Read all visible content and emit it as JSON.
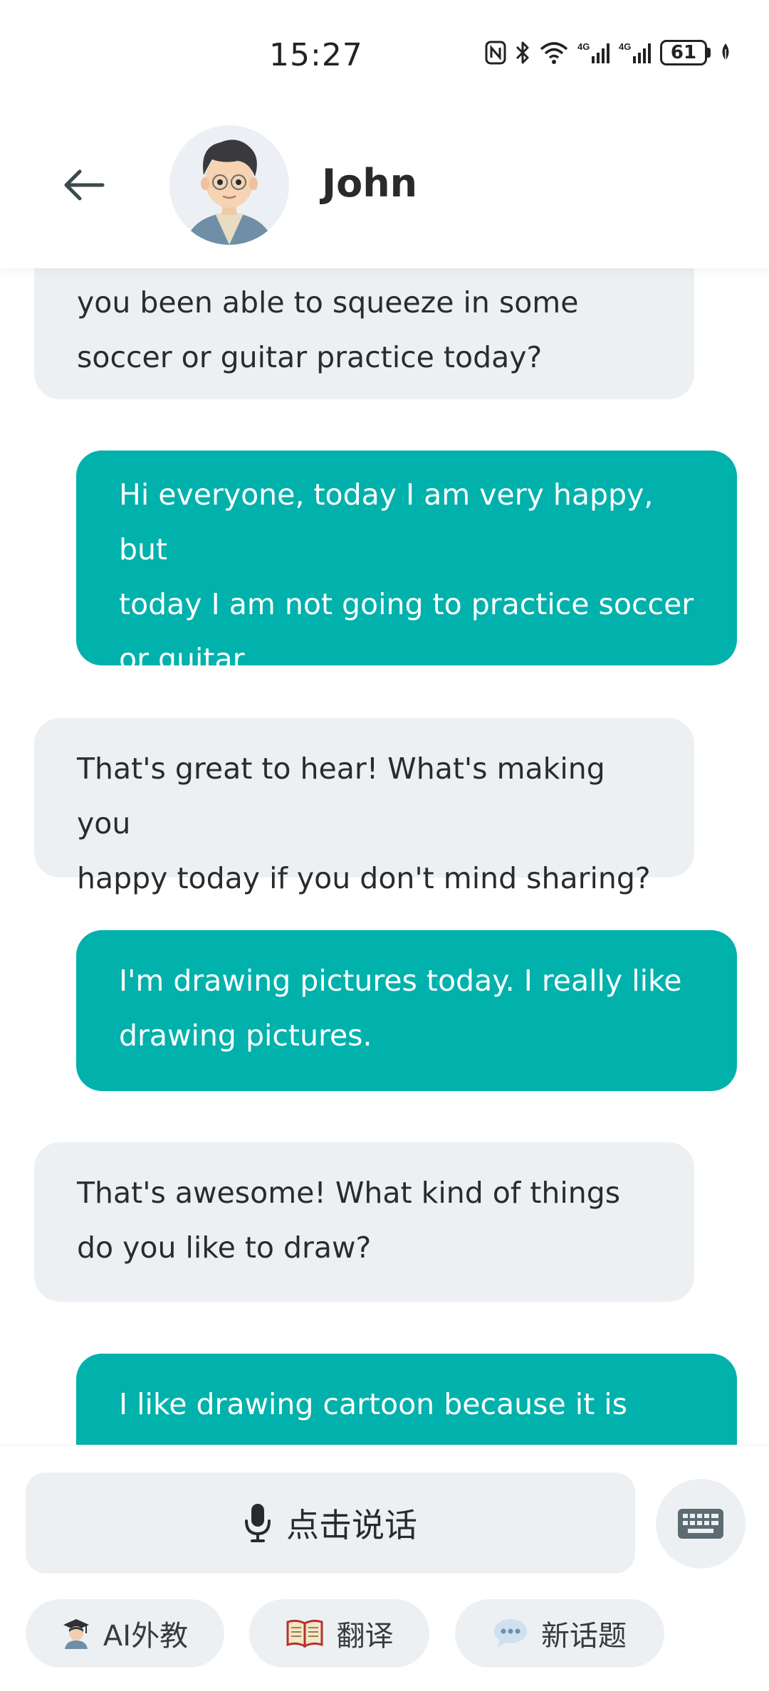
{
  "status_bar": {
    "time": "15:27",
    "battery": "61",
    "icons": [
      "nfc-icon",
      "bluetooth-icon",
      "wifi-icon",
      "signal-4g-icon",
      "signal-4g-icon",
      "battery-icon",
      "leaf-icon"
    ]
  },
  "header": {
    "back_icon": "arrow-left-icon",
    "contact_name": "John"
  },
  "messages": [
    {
      "role": "ai",
      "lines": [
        "you been able to squeeze in some",
        "soccer or guitar practice today?"
      ]
    },
    {
      "role": "user",
      "lines": [
        "Hi everyone, today I am very happy, but",
        "today I am not going to practice soccer",
        "or guitar."
      ]
    },
    {
      "role": "ai",
      "lines": [
        "That's great to hear! What's making you",
        "happy today if you don't mind sharing?"
      ]
    },
    {
      "role": "user",
      "lines": [
        "I'm drawing pictures today. I really like",
        "drawing pictures."
      ]
    },
    {
      "role": "ai",
      "lines": [
        "That's awesome! What kind of things",
        "do you like to draw?"
      ]
    },
    {
      "role": "user",
      "lines": [
        "I like drawing cartoon because it is very"
      ]
    }
  ],
  "input": {
    "talk_label": "点击说话",
    "mic_icon": "microphone-icon",
    "keyboard_icon": "keyboard-icon"
  },
  "chips": {
    "ai_teacher": "AI外教",
    "translate": "翻译",
    "new_topic": "新话题"
  },
  "colors": {
    "user_bubble": "#00b1ac",
    "ai_bubble": "#edf0f3"
  }
}
